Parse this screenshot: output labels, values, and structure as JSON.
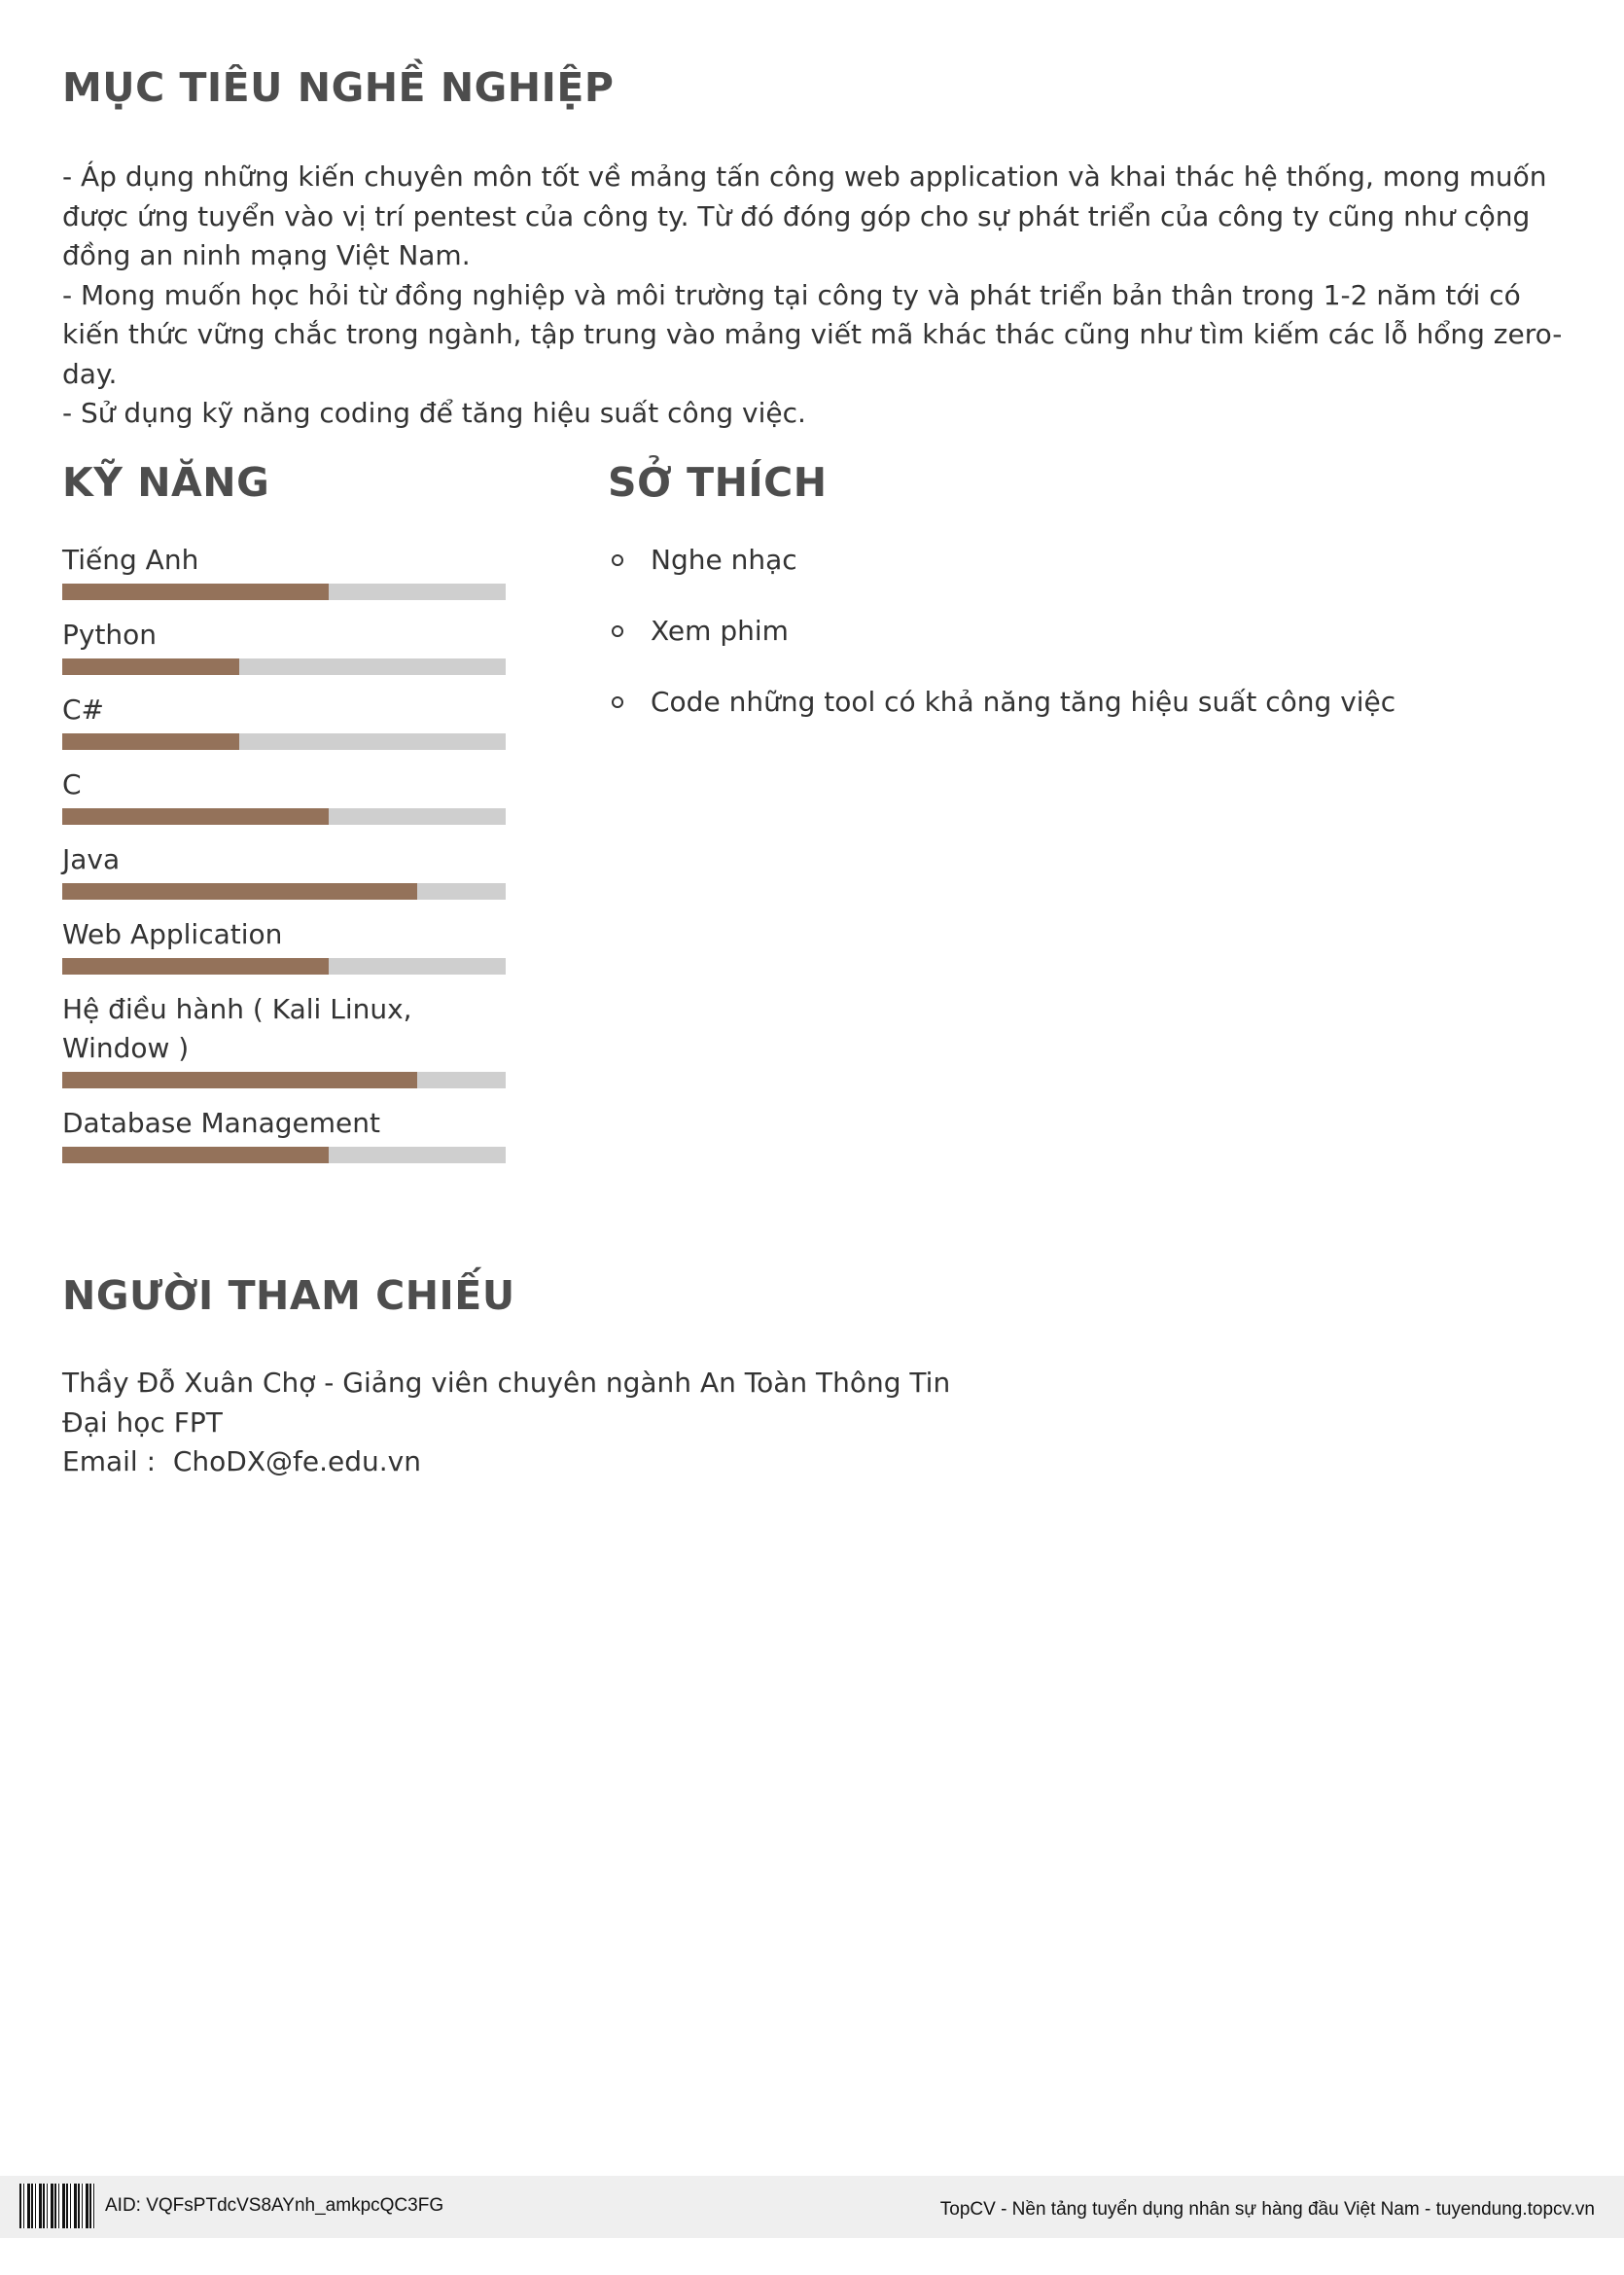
{
  "objective": {
    "title": "MỤC TIÊU NGHỀ NGHIỆP",
    "lines": [
      "- Áp dụng những kiến chuyên môn tốt về mảng tấn công web application và khai thác hệ thống, mong muốn được ứng tuyển vào vị trí pentest của công ty. Từ đó đóng góp cho sự phát triển của công ty cũng như cộng đồng an ninh mạng Việt Nam.",
      "- Mong muốn học hỏi từ đồng nghiệp và môi trường tại công ty và phát triển bản thân trong 1-2 năm tới có kiến thức vững chắc trong ngành, tập trung vào mảng viết mã khác thác cũng như tìm kiếm các lỗ hổng zero-day.",
      "- Sử dụng kỹ năng coding để tăng hiệu suất công việc."
    ]
  },
  "skills": {
    "title": "KỸ NĂNG",
    "items": [
      {
        "name": "Tiếng Anh",
        "level": 0.6
      },
      {
        "name": "Python",
        "level": 0.4
      },
      {
        "name": "C#",
        "level": 0.4
      },
      {
        "name": "C",
        "level": 0.6
      },
      {
        "name": "Java",
        "level": 0.8
      },
      {
        "name": "Web Application",
        "level": 0.6
      },
      {
        "name": "Hệ điều hành ( Kali Linux, Window )",
        "level": 0.8
      },
      {
        "name": "Database Management",
        "level": 0.6
      }
    ]
  },
  "hobbies": {
    "title": "SỞ THÍCH",
    "items": [
      "Nghe nhạc",
      "Xem phim",
      "Code những tool có khả năng tăng hiệu suất công việc"
    ]
  },
  "reference": {
    "title": "NGƯỜI THAM CHIẾU",
    "person": "Thầy Đỗ Xuân Chợ - Giảng viên chuyên ngành An Toàn Thông Tin",
    "organization": "Đại học FPT",
    "email_label": "Email :  ",
    "email": "ChoDX@fe.edu.vn"
  },
  "footer": {
    "aid": "AID: VQFsPTdcVS8AYnh_amkpcQC3FG",
    "right_text": "TopCV - Nền tảng tuyển dụng nhân sự hàng đầu Việt Nam - tuyendung.topcv.vn"
  },
  "colors": {
    "bar_fill": "#94725a",
    "bar_track": "#cfcfcf",
    "heading": "#4d4d4d"
  }
}
